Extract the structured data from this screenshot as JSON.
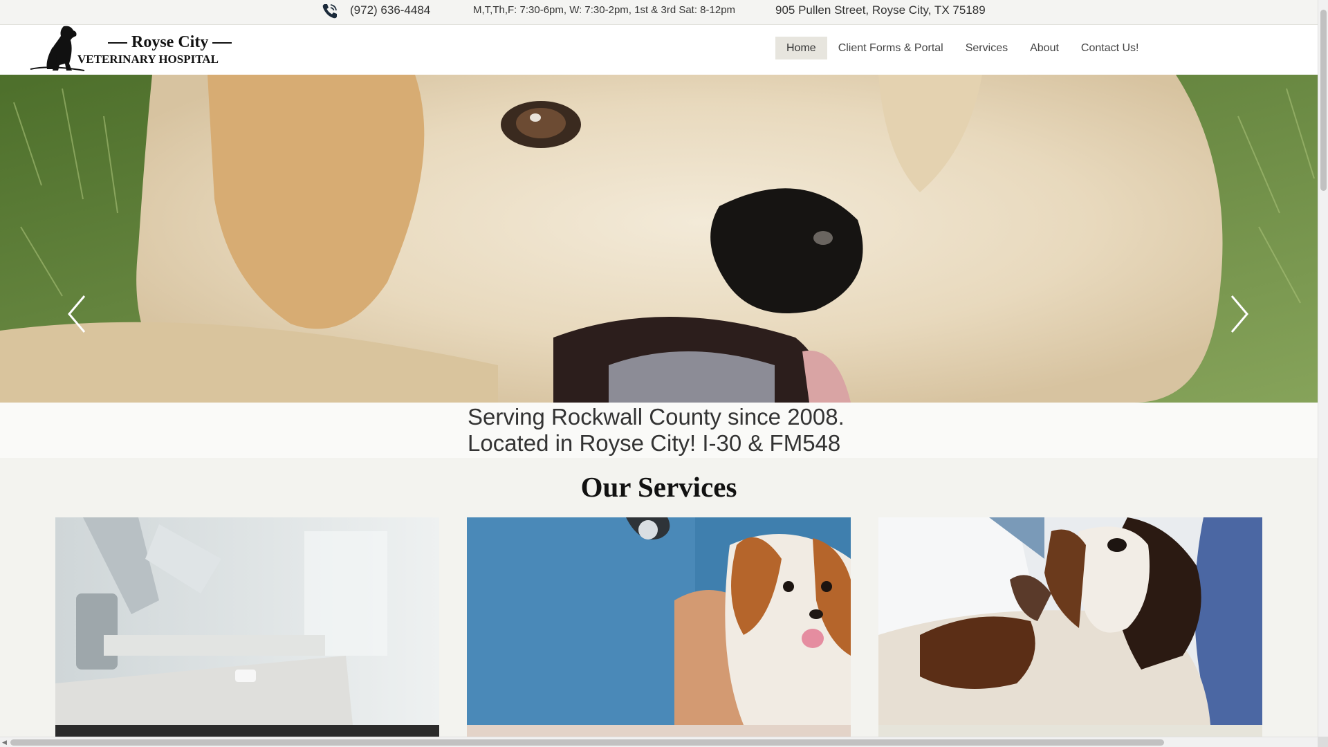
{
  "topbar": {
    "phone": "(972) 636-4484",
    "hours": "M,T,Th,F: 7:30-6pm, W: 7:30-2pm, 1st & 3rd Sat: 8-12pm",
    "address": "905 Pullen Street, Royse City, TX 75189",
    "phone_icon": "phone-icon"
  },
  "header": {
    "logo_line1": "Royse City",
    "logo_line2": "VETERINARY HOSPITAL",
    "nav": [
      {
        "label": "Home",
        "active": true
      },
      {
        "label": "Client Forms & Portal"
      },
      {
        "label": "Services"
      },
      {
        "label": "About"
      },
      {
        "label": "Contact Us!"
      }
    ]
  },
  "hero": {
    "image": "smiling-puppy-on-grass",
    "prev_icon": "chevron-left-icon",
    "next_icon": "chevron-right-icon"
  },
  "tagline": {
    "line1": "Serving Rockwall County since 2008.",
    "line2": " Located in Royse City! I-30 & FM548"
  },
  "services": {
    "title": "Our Services",
    "cards": [
      {
        "image": "laboratory-microscope",
        "band_color": "#2b2b2b"
      },
      {
        "image": "vet-with-cavalier-spaniel",
        "band_color": "#e3d3c8"
      },
      {
        "image": "basset-hound-exam",
        "band_color": "#e6e4da"
      }
    ]
  },
  "colors": {
    "background": "#f3f3ef",
    "header_bg": "#ffffff",
    "nav_active_bg": "#e7e5de"
  }
}
